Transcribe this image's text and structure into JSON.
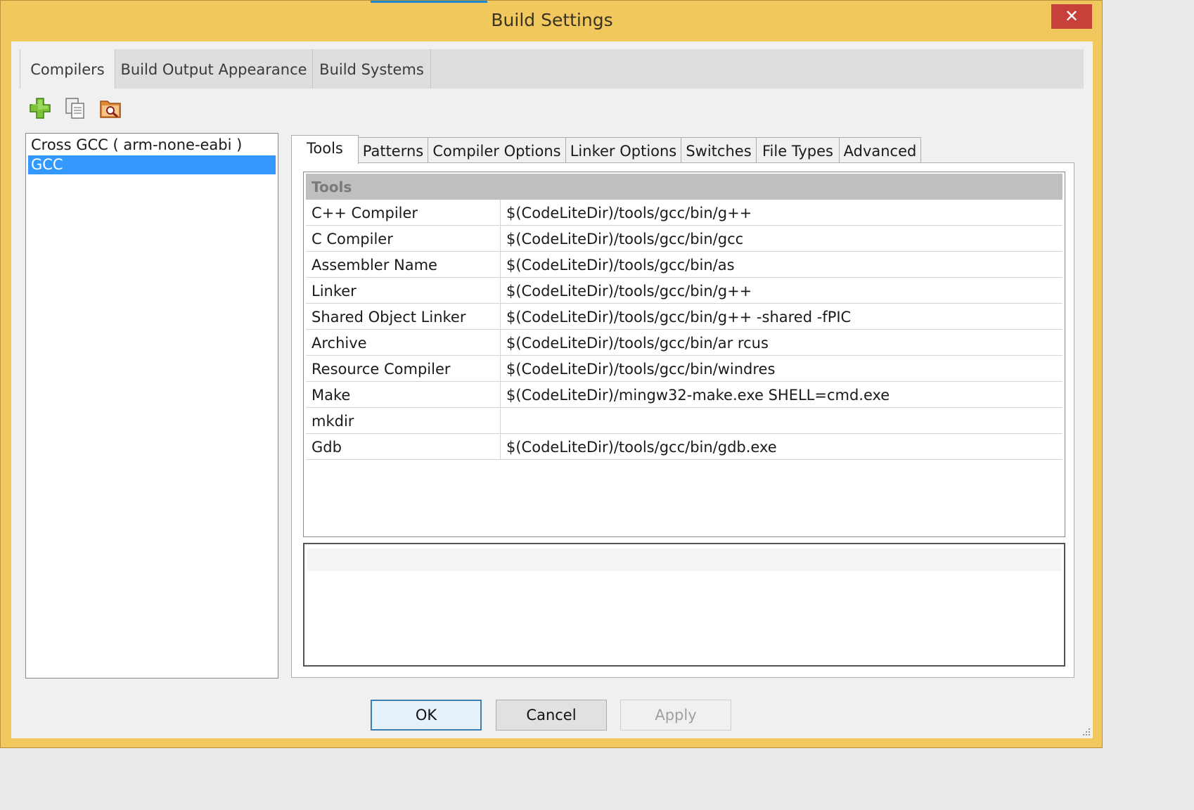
{
  "window": {
    "title": "Build Settings",
    "close_label": "✕"
  },
  "top_tabs": [
    {
      "label": "Compilers"
    },
    {
      "label": "Build Output Appearance"
    },
    {
      "label": "Build Systems"
    }
  ],
  "toolbar": {
    "icons": [
      "add-compiler-icon",
      "copy-compiler-icon",
      "scan-compilers-icon"
    ]
  },
  "compilers": {
    "items": [
      {
        "label": "Cross GCC ( arm-none-eabi )"
      },
      {
        "label": "GCC"
      }
    ],
    "selected": "GCC"
  },
  "compiler_tabs": [
    {
      "label": "Tools"
    },
    {
      "label": "Patterns"
    },
    {
      "label": "Compiler Options"
    },
    {
      "label": "Linker Options"
    },
    {
      "label": "Switches"
    },
    {
      "label": "File Types"
    },
    {
      "label": "Advanced"
    }
  ],
  "tools_grid": {
    "header": "Tools",
    "rows": [
      {
        "name": "C++ Compiler",
        "value": "$(CodeLiteDir)/tools/gcc/bin/g++"
      },
      {
        "name": "C Compiler",
        "value": "$(CodeLiteDir)/tools/gcc/bin/gcc"
      },
      {
        "name": "Assembler Name",
        "value": "$(CodeLiteDir)/tools/gcc/bin/as"
      },
      {
        "name": "Linker",
        "value": "$(CodeLiteDir)/tools/gcc/bin/g++"
      },
      {
        "name": "Shared Object Linker",
        "value": "$(CodeLiteDir)/tools/gcc/bin/g++ -shared -fPIC"
      },
      {
        "name": "Archive",
        "value": "$(CodeLiteDir)/tools/gcc/bin/ar rcus"
      },
      {
        "name": "Resource Compiler",
        "value": "$(CodeLiteDir)/tools/gcc/bin/windres"
      },
      {
        "name": "Make",
        "value": "$(CodeLiteDir)/mingw32-make.exe SHELL=cmd.exe"
      },
      {
        "name": "mkdir",
        "value": ""
      },
      {
        "name": "Gdb",
        "value": "$(CodeLiteDir)/tools/gcc/bin/gdb.exe"
      }
    ]
  },
  "buttons": {
    "ok": "OK",
    "cancel": "Cancel",
    "apply": "Apply"
  },
  "colors": {
    "title_bar": "#f0c85e",
    "close_button": "#c7413a",
    "selection": "#3399ff"
  }
}
